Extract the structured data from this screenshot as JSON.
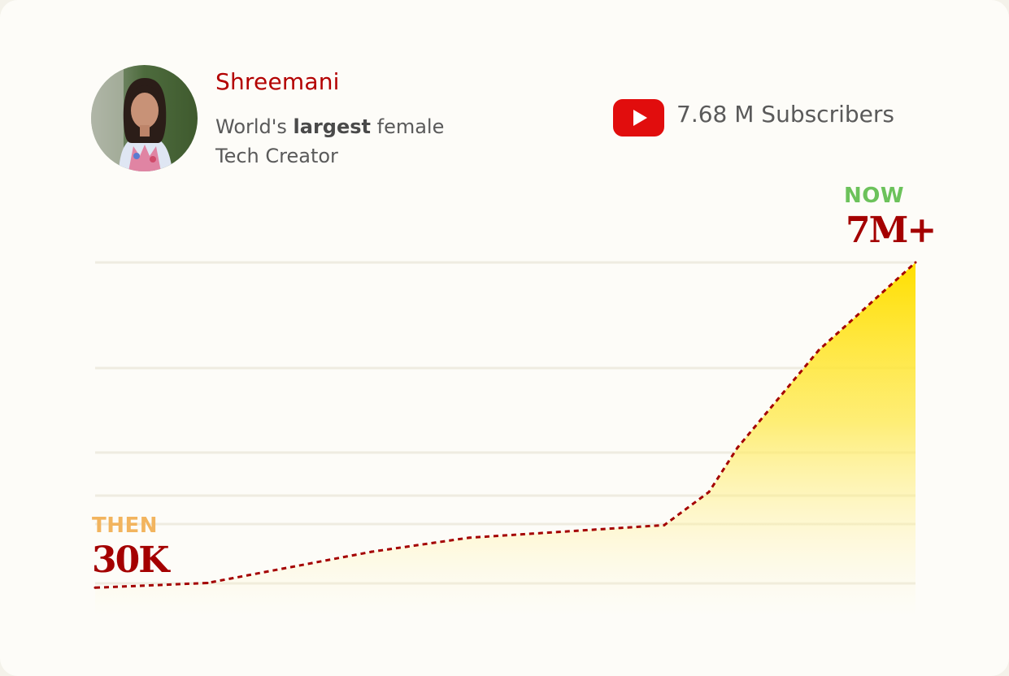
{
  "profile": {
    "name": "Shreemani",
    "tagline_prefix": "World's ",
    "tagline_bold": "largest",
    "tagline_suffix": " female",
    "tagline_line2": "Tech Creator",
    "avatar_icon": "profile-photo"
  },
  "channel": {
    "icon": "youtube-play-icon",
    "subscribers_text": "7.68 M Subscribers",
    "icon_color": "#e10d0d"
  },
  "markers": {
    "then_label": "THEN",
    "then_value": "30K",
    "now_label": "NOW",
    "now_value": "7M+"
  },
  "colors": {
    "line": "#a40000",
    "fill": "#ffe000",
    "then": "#f2b45e",
    "now": "#6cc25b",
    "name": "#b30000"
  },
  "chart_data": {
    "type": "area",
    "title": "",
    "xlabel": "",
    "ylabel": "",
    "grid": true,
    "ylim": [
      0,
      7000000
    ],
    "x": [
      0,
      1,
      2,
      3,
      4,
      5,
      6,
      7,
      8,
      9
    ],
    "values": [
      30000,
      130000,
      800000,
      1100000,
      1370000,
      2080000,
      3030000,
      5120000,
      7000000,
      7000000
    ],
    "annotations": [
      {
        "label": "THEN",
        "value": "30K",
        "position": "start"
      },
      {
        "label": "NOW",
        "value": "7M+",
        "position": "end"
      }
    ]
  }
}
